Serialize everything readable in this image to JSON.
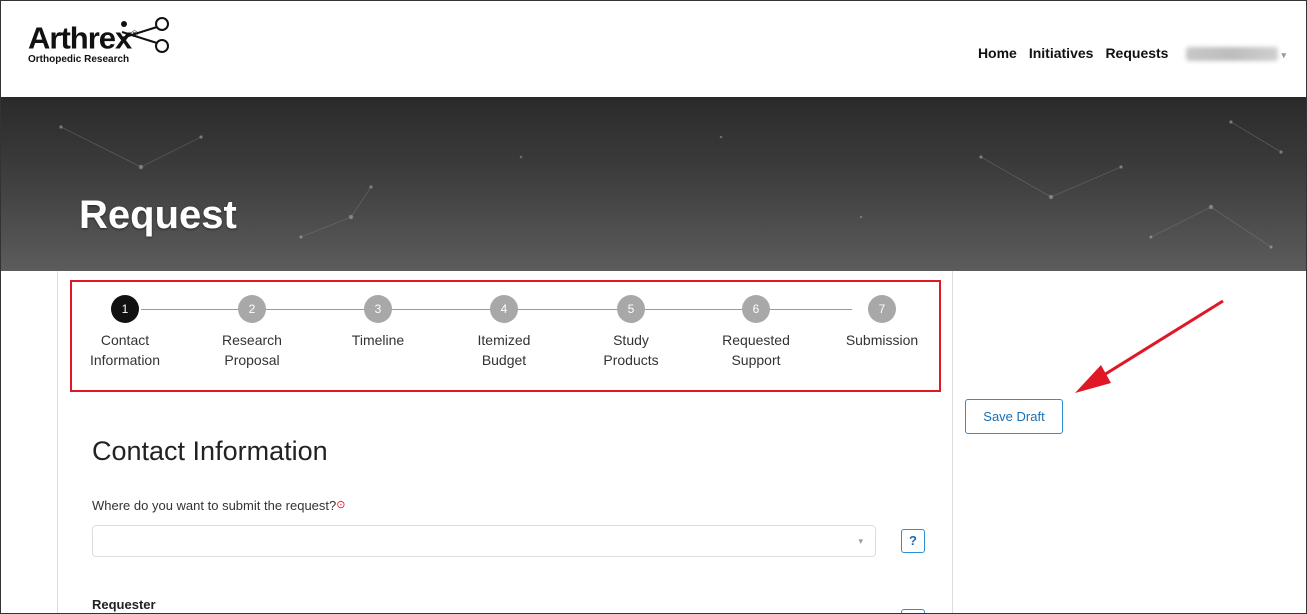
{
  "header": {
    "logo_word": "Arthrex",
    "logo_reg": "®",
    "logo_sub": "Orthopedic Research",
    "nav": [
      "Home",
      "Initiatives",
      "Requests"
    ],
    "user_caret": "▾"
  },
  "hero": {
    "title": "Request"
  },
  "steps": [
    {
      "num": "1",
      "line1": "Contact",
      "line2": "Information",
      "active": true
    },
    {
      "num": "2",
      "line1": "Research",
      "line2": "Proposal",
      "active": false
    },
    {
      "num": "3",
      "line1": "Timeline",
      "line2": "",
      "active": false
    },
    {
      "num": "4",
      "line1": "Itemized",
      "line2": "Budget",
      "active": false
    },
    {
      "num": "5",
      "line1": "Study",
      "line2": "Products",
      "active": false
    },
    {
      "num": "6",
      "line1": "Requested",
      "line2": "Support",
      "active": false
    },
    {
      "num": "7",
      "line1": "Submission",
      "line2": "",
      "active": false
    }
  ],
  "form": {
    "section_title": "Contact Information",
    "question": "Where do you want to submit the request?",
    "required_mark": "⊙",
    "select_value": "",
    "select_arrow": "▾",
    "help_label": "?",
    "requester_label": "Requester"
  },
  "actions": {
    "save_draft": "Save Draft"
  },
  "colors": {
    "highlight": "#e01826",
    "accent": "#1a6fb3",
    "step_active": "#111111",
    "step_inactive": "#a8a8a8"
  }
}
